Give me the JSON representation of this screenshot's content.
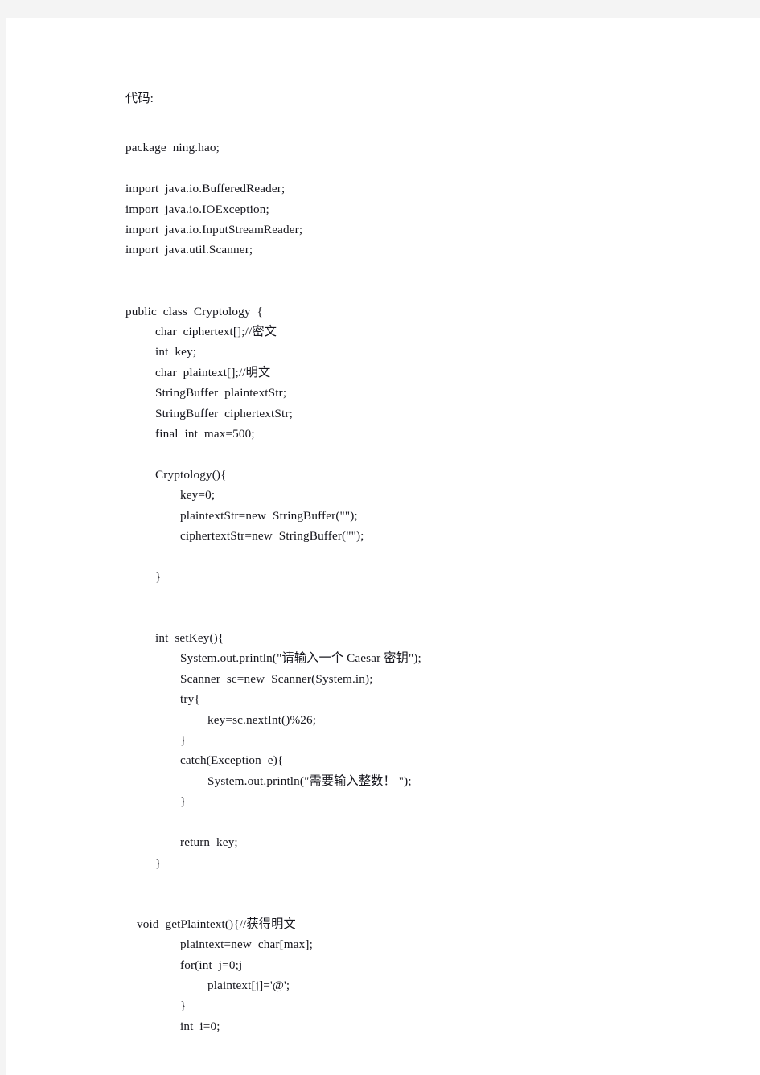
{
  "document": {
    "heading": "代码:",
    "background_color": "#ffffff",
    "canvas_color": "#f4f4f4",
    "text_color": "#15151c",
    "lines": [
      {
        "id": "package",
        "indent": 0,
        "text": "package  ning.hao;"
      },
      {
        "id": "blank-1",
        "indent": 0,
        "text": ""
      },
      {
        "id": "import-bufferedreader",
        "indent": 0,
        "text": "import  java.io.BufferedReader;"
      },
      {
        "id": "import-ioexception",
        "indent": 0,
        "text": "import  java.io.IOException;"
      },
      {
        "id": "import-inputstreamreader",
        "indent": 0,
        "text": "import  java.io.InputStreamReader;"
      },
      {
        "id": "import-scanner",
        "indent": 0,
        "text": "import  java.util.Scanner;"
      },
      {
        "id": "blank-2",
        "indent": 0,
        "text": ""
      },
      {
        "id": "blank-3",
        "indent": 0,
        "text": ""
      },
      {
        "id": "class-decl",
        "indent": 0,
        "text": "public  class  Cryptology  {"
      },
      {
        "id": "field-ciphertext",
        "indent": 1,
        "text": "char  ciphertext[];//密文"
      },
      {
        "id": "field-key",
        "indent": 1,
        "text": "int  key;"
      },
      {
        "id": "field-plaintext",
        "indent": 1,
        "text": "char  plaintext[];//明文"
      },
      {
        "id": "field-plaintextstr",
        "indent": 1,
        "text": "StringBuffer  plaintextStr;"
      },
      {
        "id": "field-ciphertextstr",
        "indent": 1,
        "text": "StringBuffer  ciphertextStr;"
      },
      {
        "id": "field-max",
        "indent": 1,
        "text": "final  int  max=500;"
      },
      {
        "id": "blank-4",
        "indent": 0,
        "text": ""
      },
      {
        "id": "ctor-open",
        "indent": 1,
        "text": "Cryptology(){"
      },
      {
        "id": "ctor-key-init",
        "indent": 2,
        "text": "key=0;"
      },
      {
        "id": "ctor-plaintextstr-init",
        "indent": 2,
        "text": "plaintextStr=new  StringBuffer(\"\");"
      },
      {
        "id": "ctor-ciphertextstr-init",
        "indent": 2,
        "text": "ciphertextStr=new  StringBuffer(\"\");"
      },
      {
        "id": "blank-5",
        "indent": 0,
        "text": ""
      },
      {
        "id": "ctor-close",
        "indent": 1,
        "text": "}"
      },
      {
        "id": "blank-6",
        "indent": 0,
        "text": ""
      },
      {
        "id": "blank-7",
        "indent": 0,
        "text": ""
      },
      {
        "id": "setkey-open",
        "indent": 1,
        "text": "int  setKey(){"
      },
      {
        "id": "setkey-prompt",
        "indent": 2,
        "text": "System.out.println(\"请输入一个 Caesar 密钥\");"
      },
      {
        "id": "setkey-scanner",
        "indent": 2,
        "text": "Scanner  sc=new  Scanner(System.in);"
      },
      {
        "id": "setkey-try",
        "indent": 2,
        "text": "try{"
      },
      {
        "id": "setkey-assign",
        "indent": 3,
        "text": "key=sc.nextInt()%26;"
      },
      {
        "id": "setkey-try-close",
        "indent": 2,
        "text": "}"
      },
      {
        "id": "setkey-catch",
        "indent": 2,
        "text": "catch(Exception  e){"
      },
      {
        "id": "setkey-catch-msg",
        "indent": 3,
        "text": "System.out.println(\"需要输入整数！ \");"
      },
      {
        "id": "setkey-catch-close",
        "indent": 2,
        "text": "}"
      },
      {
        "id": "blank-8",
        "indent": 0,
        "text": ""
      },
      {
        "id": "setkey-return",
        "indent": 2,
        "text": "return  key;"
      },
      {
        "id": "setkey-close",
        "indent": 1,
        "text": "}"
      },
      {
        "id": "blank-9",
        "indent": 0,
        "text": ""
      },
      {
        "id": "blank-10",
        "indent": 0,
        "text": ""
      },
      {
        "id": "getplaintext-open",
        "indent": "void",
        "text": "void  getPlaintext(){//获得明文"
      },
      {
        "id": "getplaintext-alloc",
        "indent": 2,
        "text": "plaintext=new  char[max];"
      },
      {
        "id": "getplaintext-for",
        "indent": 2,
        "text": "for(int  j=0;j"
      },
      {
        "id": "getplaintext-fill",
        "indent": 3,
        "text": "plaintext[j]='@';"
      },
      {
        "id": "getplaintext-for-close",
        "indent": 2,
        "text": "}"
      },
      {
        "id": "getplaintext-i-init",
        "indent": 2,
        "text": "int  i=0;"
      }
    ]
  }
}
